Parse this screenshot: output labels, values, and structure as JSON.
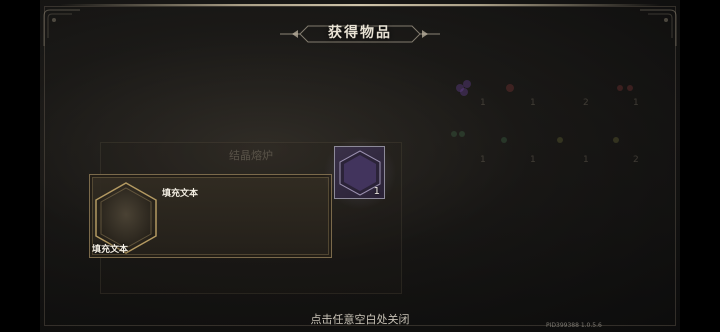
{
  "dialog": {
    "title": "获得物品",
    "close_hint": "点击任意空白处关闭"
  },
  "background_panel": {
    "title": "结晶熔炉",
    "counts_row1": [
      "1",
      "1",
      "2",
      "1"
    ],
    "counts_row2": [
      "1",
      "1",
      "1",
      "2"
    ]
  },
  "item_detail": {
    "name": "填充文本",
    "description": "填充文本"
  },
  "rewards": [
    {
      "count": "1"
    }
  ],
  "footer": {
    "version": "PID399388 1.0.5.6"
  },
  "colors": {
    "accent_gold": "#7b6a4b",
    "reward_purple": "#3a3149"
  }
}
